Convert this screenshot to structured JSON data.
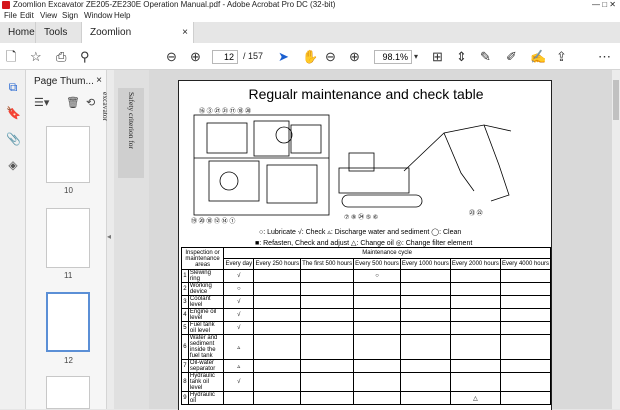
{
  "window": {
    "title": "Zoomlion Excavator ZE205-ZE230E Operation Manual.pdf - Adobe Acrobat Pro DC (32-bit)",
    "controls": "—  □  ✕"
  },
  "menu": [
    "File",
    "Edit",
    "View",
    "Sign",
    "Window",
    "Help"
  ],
  "tabs": {
    "home": "Home",
    "tools": "Tools",
    "doc": "Zoomlion Excavator...",
    "close": "×"
  },
  "toolbar": {
    "page_current": "12",
    "page_total": "/ 157",
    "zoom": "98.1%"
  },
  "sidebar": {
    "title": "Page Thum...",
    "close": "×",
    "thumbs": [
      {
        "label": "10"
      },
      {
        "label": "11"
      },
      {
        "label": "12"
      }
    ]
  },
  "bookmark": {
    "label": "Safety criterion for excavator"
  },
  "doc": {
    "title": "Regualr maintenance and check table",
    "legend1": "○: Lubricate   √: Check   ▵: Discharge water and sediment   ◯: Clean",
    "legend2": "■: Refasten,  Check and adjust   △: Change oil   ◎: Change filter element",
    "table": {
      "col_header": "Inspection or maintenance areas",
      "cycle_header": "Maintenance cycle",
      "cycles": [
        "Every day",
        "Every 250 hours",
        "The first 500 hours",
        "Every 500 hours",
        "Every 1000 hours",
        "Every 2000 hours",
        "Every 4000 hours"
      ],
      "rows": [
        {
          "n": "1",
          "name": "Slewing ring",
          "marks": [
            "√",
            "",
            "",
            "○",
            "",
            "",
            ""
          ]
        },
        {
          "n": "2",
          "name": "Working device",
          "marks": [
            "○",
            "",
            "",
            "",
            "",
            "",
            ""
          ]
        },
        {
          "n": "3",
          "name": "Coolant level",
          "marks": [
            "√",
            "",
            "",
            "",
            "",
            "",
            ""
          ]
        },
        {
          "n": "4",
          "name": "Engine oil level",
          "marks": [
            "√",
            "",
            "",
            "",
            "",
            "",
            ""
          ]
        },
        {
          "n": "5",
          "name": "Fuel tank oil level",
          "marks": [
            "√",
            "",
            "",
            "",
            "",
            "",
            ""
          ]
        },
        {
          "n": "6",
          "name": "Water and sediment inside the fuel tank",
          "marks": [
            "▵",
            "",
            "",
            "",
            "",
            "",
            ""
          ]
        },
        {
          "n": "7",
          "name": "Oil-water separator",
          "marks": [
            "▵",
            "",
            "",
            "",
            "",
            "",
            ""
          ]
        },
        {
          "n": "8",
          "name": "Hydraulic tank oil level",
          "marks": [
            "√",
            "",
            "",
            "",
            "",
            "",
            ""
          ]
        },
        {
          "n": "9",
          "name": "Hydraulic oil",
          "marks": [
            "",
            "",
            "",
            "",
            "",
            "△",
            ""
          ]
        }
      ]
    }
  }
}
